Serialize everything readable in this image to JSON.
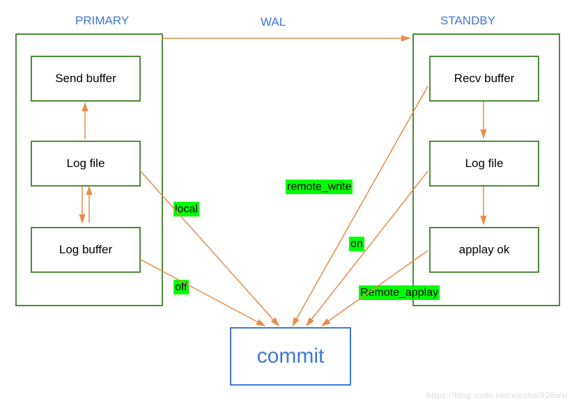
{
  "titles": {
    "primary": "PRIMARY",
    "wal": "WAL",
    "standby": "STANDBY"
  },
  "primary": {
    "send_buffer": "Send buffer",
    "log_file": "Log file",
    "log_buffer": "Log buffer"
  },
  "standby": {
    "recv_buffer": "Recv buffer",
    "log_file": "Log file",
    "applay_ok": "applay ok"
  },
  "tags": {
    "local": "local",
    "off": "off",
    "remote_write": "remote_write",
    "on": "on",
    "remote_applay": "Remote_applay"
  },
  "commit": "commit",
  "watermark": "https://blog.csdn.net/xiaohai928ww",
  "chart_data": {
    "type": "diagram",
    "title": "PostgreSQL synchronous_commit modes and WAL replication flow",
    "nodes": [
      {
        "id": "primary",
        "label": "PRIMARY",
        "children": [
          "send_buffer",
          "p_log_file",
          "log_buffer"
        ]
      },
      {
        "id": "send_buffer",
        "label": "Send buffer"
      },
      {
        "id": "p_log_file",
        "label": "Log file"
      },
      {
        "id": "log_buffer",
        "label": "Log buffer"
      },
      {
        "id": "standby",
        "label": "STANDBY",
        "children": [
          "recv_buffer",
          "s_log_file",
          "applay_ok"
        ]
      },
      {
        "id": "recv_buffer",
        "label": "Recv buffer"
      },
      {
        "id": "s_log_file",
        "label": "Log file"
      },
      {
        "id": "applay_ok",
        "label": "applay ok"
      },
      {
        "id": "commit",
        "label": "commit"
      }
    ],
    "edges": [
      {
        "from": "primary",
        "to": "standby",
        "label": "WAL"
      },
      {
        "from": "p_log_file",
        "to": "send_buffer",
        "bidirectional": false
      },
      {
        "from": "p_log_file",
        "to": "log_buffer",
        "bidirectional": true
      },
      {
        "from": "recv_buffer",
        "to": "s_log_file",
        "bidirectional": false
      },
      {
        "from": "s_log_file",
        "to": "applay_ok",
        "bidirectional": false
      },
      {
        "from": "log_buffer",
        "to": "commit",
        "label": "off"
      },
      {
        "from": "p_log_file",
        "to": "commit",
        "label": "local"
      },
      {
        "from": "recv_buffer",
        "to": "commit",
        "label": "remote_write"
      },
      {
        "from": "s_log_file",
        "to": "commit",
        "label": "on"
      },
      {
        "from": "applay_ok",
        "to": "commit",
        "label": "Remote_applay"
      }
    ],
    "sync_commit_levels": [
      "off",
      "local",
      "remote_write",
      "on",
      "Remote_applay"
    ]
  }
}
